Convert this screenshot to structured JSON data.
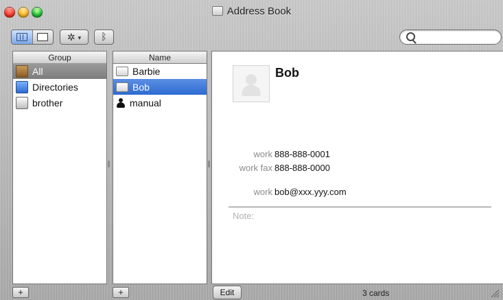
{
  "window": {
    "title": "Address Book"
  },
  "toolbar": {
    "search_placeholder": ""
  },
  "groups": {
    "header": "Group",
    "items": [
      {
        "label": "All",
        "selected": true,
        "icon": "all-group-icon"
      },
      {
        "label": "Directories",
        "selected": false,
        "icon": "directories-icon"
      },
      {
        "label": "brother",
        "selected": false,
        "icon": "brother-group-icon"
      }
    ]
  },
  "names": {
    "header": "Name",
    "items": [
      {
        "label": "Barbie",
        "selected": false,
        "icon": "contact-card-icon"
      },
      {
        "label": "Bob",
        "selected": true,
        "icon": "contact-card-icon"
      },
      {
        "label": "manual",
        "selected": false,
        "icon": "person-icon"
      }
    ]
  },
  "card": {
    "name": "Bob",
    "fields": [
      {
        "label": "work",
        "value": "888-888-0001"
      },
      {
        "label": "work fax",
        "value": "888-888-0000"
      },
      {
        "label": "work",
        "value": "bob@xxx.yyy.com"
      }
    ],
    "note_label": "Note:"
  },
  "footer": {
    "edit_label": "Edit",
    "count_text": "3 cards",
    "add_symbol": "+"
  },
  "colors": {
    "selection_blue": "#2e6bd1",
    "selection_gray": "#7d7d7d"
  }
}
